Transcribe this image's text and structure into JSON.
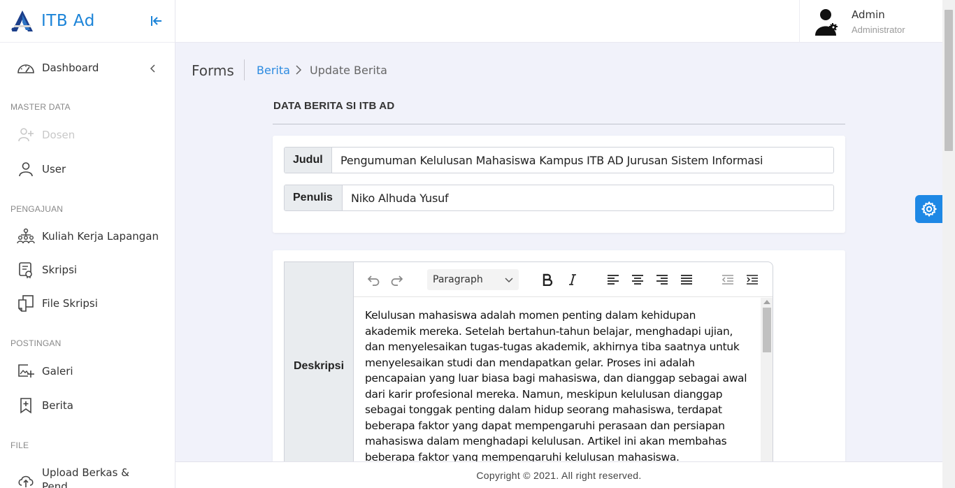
{
  "brand": {
    "name": "ITB Ad"
  },
  "sidebar": {
    "dashboard": "Dashboard",
    "sections": {
      "master_data": "MASTER DATA",
      "pengajuan": "PENGAJUAN",
      "postingan": "POSTINGAN",
      "file": "FILE"
    },
    "items": {
      "dosen": "Dosen",
      "user": "User",
      "kkl": "Kuliah Kerja Lapangan",
      "skripsi": "Skripsi",
      "file_skripsi": "File Skripsi",
      "galeri": "Galeri",
      "berita": "Berita",
      "upload_line1": "Upload Berkas &",
      "upload_line2": "Pend"
    }
  },
  "header": {
    "user_name": "Admin",
    "user_role": "Administrator"
  },
  "breadcrumb": {
    "title": "Forms",
    "parent": "Berita",
    "current": "Update Berita"
  },
  "form": {
    "heading": "DATA BERITA SI ITB AD",
    "judul_label": "Judul",
    "judul_value": "Pengumuman Kelulusan Mahasiswa Kampus ITB AD Jurusan Sistem Informasi",
    "penulis_label": "Penulis",
    "penulis_value": "Niko Alhuda Yusuf",
    "deskripsi_label": "Deskripsi",
    "paragraph_select": "Paragraph",
    "deskripsi_text": "Kelulusan mahasiswa adalah momen penting dalam kehidupan akademik mereka. Setelah bertahun-tahun belajar, menghadapi ujian, dan menyelesaikan tugas-tugas akademik, akhirnya tiba saatnya untuk menyelesaikan studi dan mendapatkan gelar. Proses ini adalah pencapaian yang luar biasa bagi mahasiswa, dan dianggap sebagai awal dari karir profesional mereka. Namun, meskipun kelulusan dianggap sebagai tonggak penting dalam hidup seorang mahasiswa, terdapat beberapa faktor yang dapat mempengaruhi perasaan dan persiapan mahasiswa dalam menghadapi kelulusan. Artikel ini akan membahas beberapa faktor yang mempengaruhi kelulusan mahasiswa."
  },
  "footer": {
    "copyright": "Copyright © 2021. All right reserved."
  },
  "colors": {
    "accent": "#1e88e5",
    "link": "#2c8be0"
  },
  "icons": [
    "logo-icon",
    "collapse-icon",
    "dashboard-icon",
    "user-plus-icon",
    "user-icon",
    "people-network-icon",
    "scroll-icon",
    "files-icon",
    "image-plus-icon",
    "bookmark-plus-icon",
    "upload-cloud-icon",
    "gear-icon",
    "undo-icon",
    "redo-icon",
    "bold-icon",
    "italic-icon",
    "align-left-icon",
    "align-center-icon",
    "align-right-icon",
    "align-justify-icon",
    "outdent-icon",
    "indent-icon"
  ]
}
